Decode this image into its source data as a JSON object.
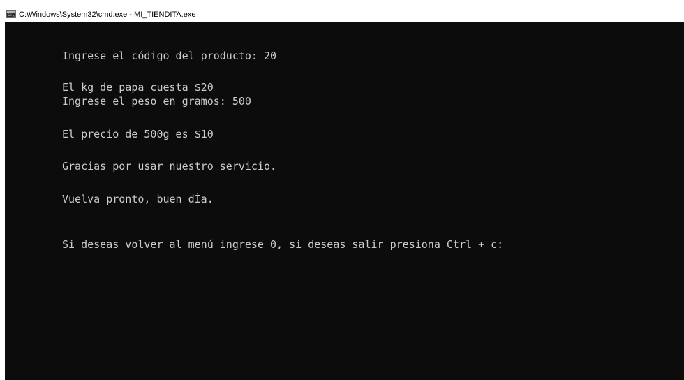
{
  "window": {
    "title": "C:\\Windows\\System32\\cmd.exe - MI_TIENDITA.exe",
    "icon": "cmd-icon",
    "icon_glyph": "C:\\"
  },
  "console": {
    "lines": [
      "Ingrese el código del producto: 20",
      "El kg de papa cuesta $20",
      "Ingrese el peso en gramos: 500",
      "El precio de 500g es $10",
      "Gracias por usar nuestro servicio.",
      "Vuelva pronto, buen dÍa.",
      "Si deseas volver al menú ingrese 0, si deseas salir presiona Ctrl + c:"
    ]
  },
  "colors": {
    "console_background": "#0c0c0c",
    "console_text": "#cccccc",
    "titlebar_background": "#ffffff",
    "titlebar_text": "#000000"
  }
}
